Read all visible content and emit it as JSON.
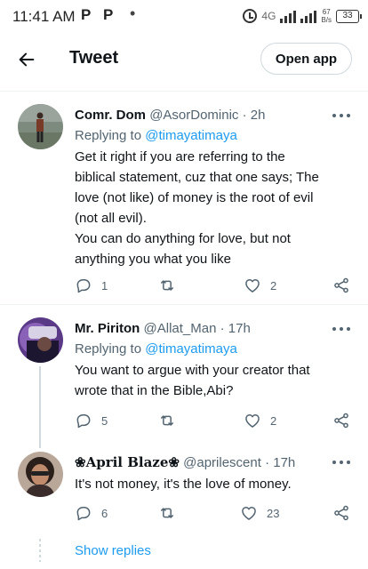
{
  "status_bar": {
    "time": "11:41 AM",
    "app_icons": [
      "P",
      "P"
    ],
    "network_type": "4G",
    "speed_value": "67",
    "speed_unit": "B/s",
    "battery": "33"
  },
  "header": {
    "title": "Tweet",
    "open_app_label": "Open app"
  },
  "tweets": [
    {
      "name": "Comr. Dom",
      "handle": "@AsorDominic",
      "separator": "·",
      "time": "2h",
      "replying_prefix": "Replying to",
      "replying_to": "@timayatimaya",
      "text_lines": [
        "Get it right if you are referring to the",
        "biblical statement, cuz that one says; The",
        "love (not like) of money is the root of evil",
        "(not all evil).",
        "You can do anything for love, but not",
        "anything you what you like"
      ],
      "replies": "1",
      "retweets": "",
      "likes": "2"
    },
    {
      "name": "Mr. Piriton",
      "handle": "@Allat_Man",
      "separator": "·",
      "time": "17h",
      "replying_prefix": "Replying to",
      "replying_to": "@timayatimaya",
      "text_lines": [
        "You want to argue with your creator that",
        "wrote that in the Bible,Abi?"
      ],
      "replies": "5",
      "retweets": "",
      "likes": "2"
    },
    {
      "name": "❀April Blaze❀",
      "handle": "@aprilescent",
      "separator": "·",
      "time": "17h",
      "text_lines": [
        "It's not money, it's the love of money."
      ],
      "replies": "6",
      "retweets": "",
      "likes": "23"
    }
  ],
  "show_replies_label": "Show replies",
  "colors": {
    "accent": "#1d9bf0",
    "secondary_text": "#536471",
    "border": "#cfd9de"
  }
}
